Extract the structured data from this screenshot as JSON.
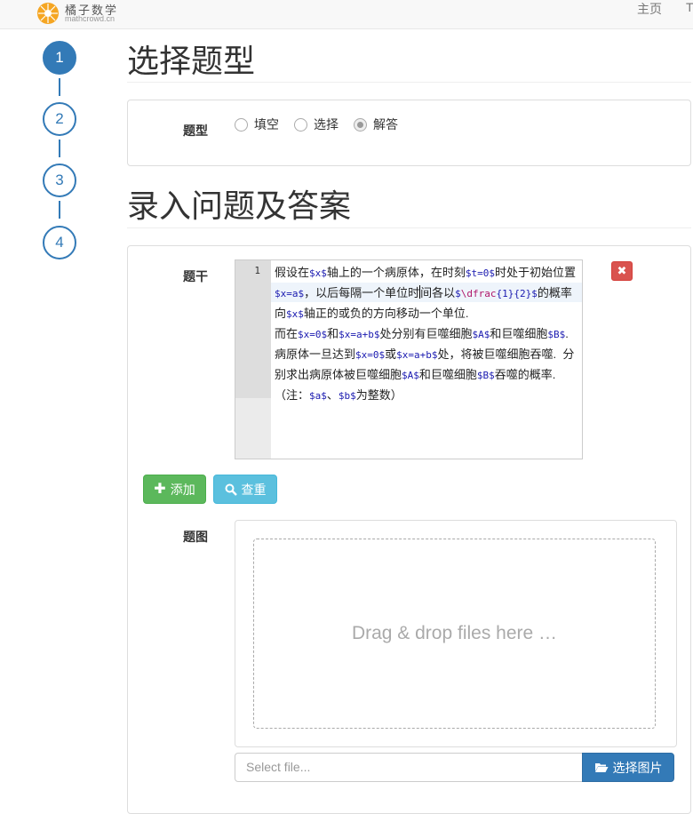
{
  "brand": {
    "name": "橘子数学",
    "domain": "mathcrowd.cn"
  },
  "nav": {
    "home": "主页",
    "extra": "T"
  },
  "steps": [
    "1",
    "2",
    "3",
    "4"
  ],
  "sections": {
    "type_title": "选择题型",
    "entry_title": "录入问题及答案"
  },
  "type_panel": {
    "label": "题型",
    "options": [
      {
        "label": "填空",
        "checked": false
      },
      {
        "label": "选择",
        "checked": false
      },
      {
        "label": "解答",
        "checked": true
      }
    ]
  },
  "stem_panel": {
    "label": "题干",
    "line_number": "1",
    "add_label": "添加",
    "check_label": "查重",
    "image_label": "题图",
    "dropzone_text": "Drag & drop files here …",
    "file_placeholder": "Select file...",
    "pick_label": "选择图片"
  },
  "editor_segments": [
    {
      "t": "假设在",
      "c": "txt"
    },
    {
      "t": "$x$",
      "c": "m"
    },
    {
      "t": "轴上的一个病原体，在时刻",
      "c": "txt"
    },
    {
      "t": "$t=0$",
      "c": "m"
    },
    {
      "t": "时处于初始位置",
      "c": "txt"
    },
    {
      "t": "$x=a$",
      "c": "m"
    },
    {
      "t": "，以后每隔一个单位时",
      "c": "txt"
    },
    {
      "t": "|",
      "c": "cursor"
    },
    {
      "t": "间各以",
      "c": "txt"
    },
    {
      "t": "$",
      "c": "m"
    },
    {
      "t": "\\dfrac",
      "c": "mr"
    },
    {
      "t": "{1}{2}",
      "c": "m"
    },
    {
      "t": "$",
      "c": "m"
    },
    {
      "t": "的概率向",
      "c": "txt"
    },
    {
      "t": "$x$",
      "c": "m"
    },
    {
      "t": "轴正的或负的方向移动一个单位.",
      "c": "txt"
    },
    {
      "t": "\n",
      "c": "br"
    },
    {
      "t": "而在",
      "c": "txt"
    },
    {
      "t": "$x=0$",
      "c": "m"
    },
    {
      "t": "和",
      "c": "txt"
    },
    {
      "t": "$x=a+b$",
      "c": "m"
    },
    {
      "t": "处分别有巨噬细胞",
      "c": "txt"
    },
    {
      "t": "$A$",
      "c": "m"
    },
    {
      "t": "和巨噬细胞",
      "c": "txt"
    },
    {
      "t": "$B$",
      "c": "m"
    },
    {
      "t": ". 病原体一旦达到",
      "c": "txt"
    },
    {
      "t": "$x=0$",
      "c": "m"
    },
    {
      "t": "或",
      "c": "txt"
    },
    {
      "t": "$x=a+b$",
      "c": "m"
    },
    {
      "t": "处，将被巨噬细胞吞噬.  分别求出病原体被巨噬细胞",
      "c": "txt"
    },
    {
      "t": "$A$",
      "c": "m"
    },
    {
      "t": "和巨噬细胞",
      "c": "txt"
    },
    {
      "t": "$B$",
      "c": "m"
    },
    {
      "t": "吞噬的概率. （注：",
      "c": "txt"
    },
    {
      "t": "$a$",
      "c": "m"
    },
    {
      "t": "、",
      "c": "txt"
    },
    {
      "t": "$b$",
      "c": "m"
    },
    {
      "t": "为整数）",
      "c": "txt"
    }
  ],
  "colors": {
    "primary": "#337ab7",
    "success": "#5cb85c",
    "info": "#5bc0de",
    "danger": "#d9534f"
  }
}
